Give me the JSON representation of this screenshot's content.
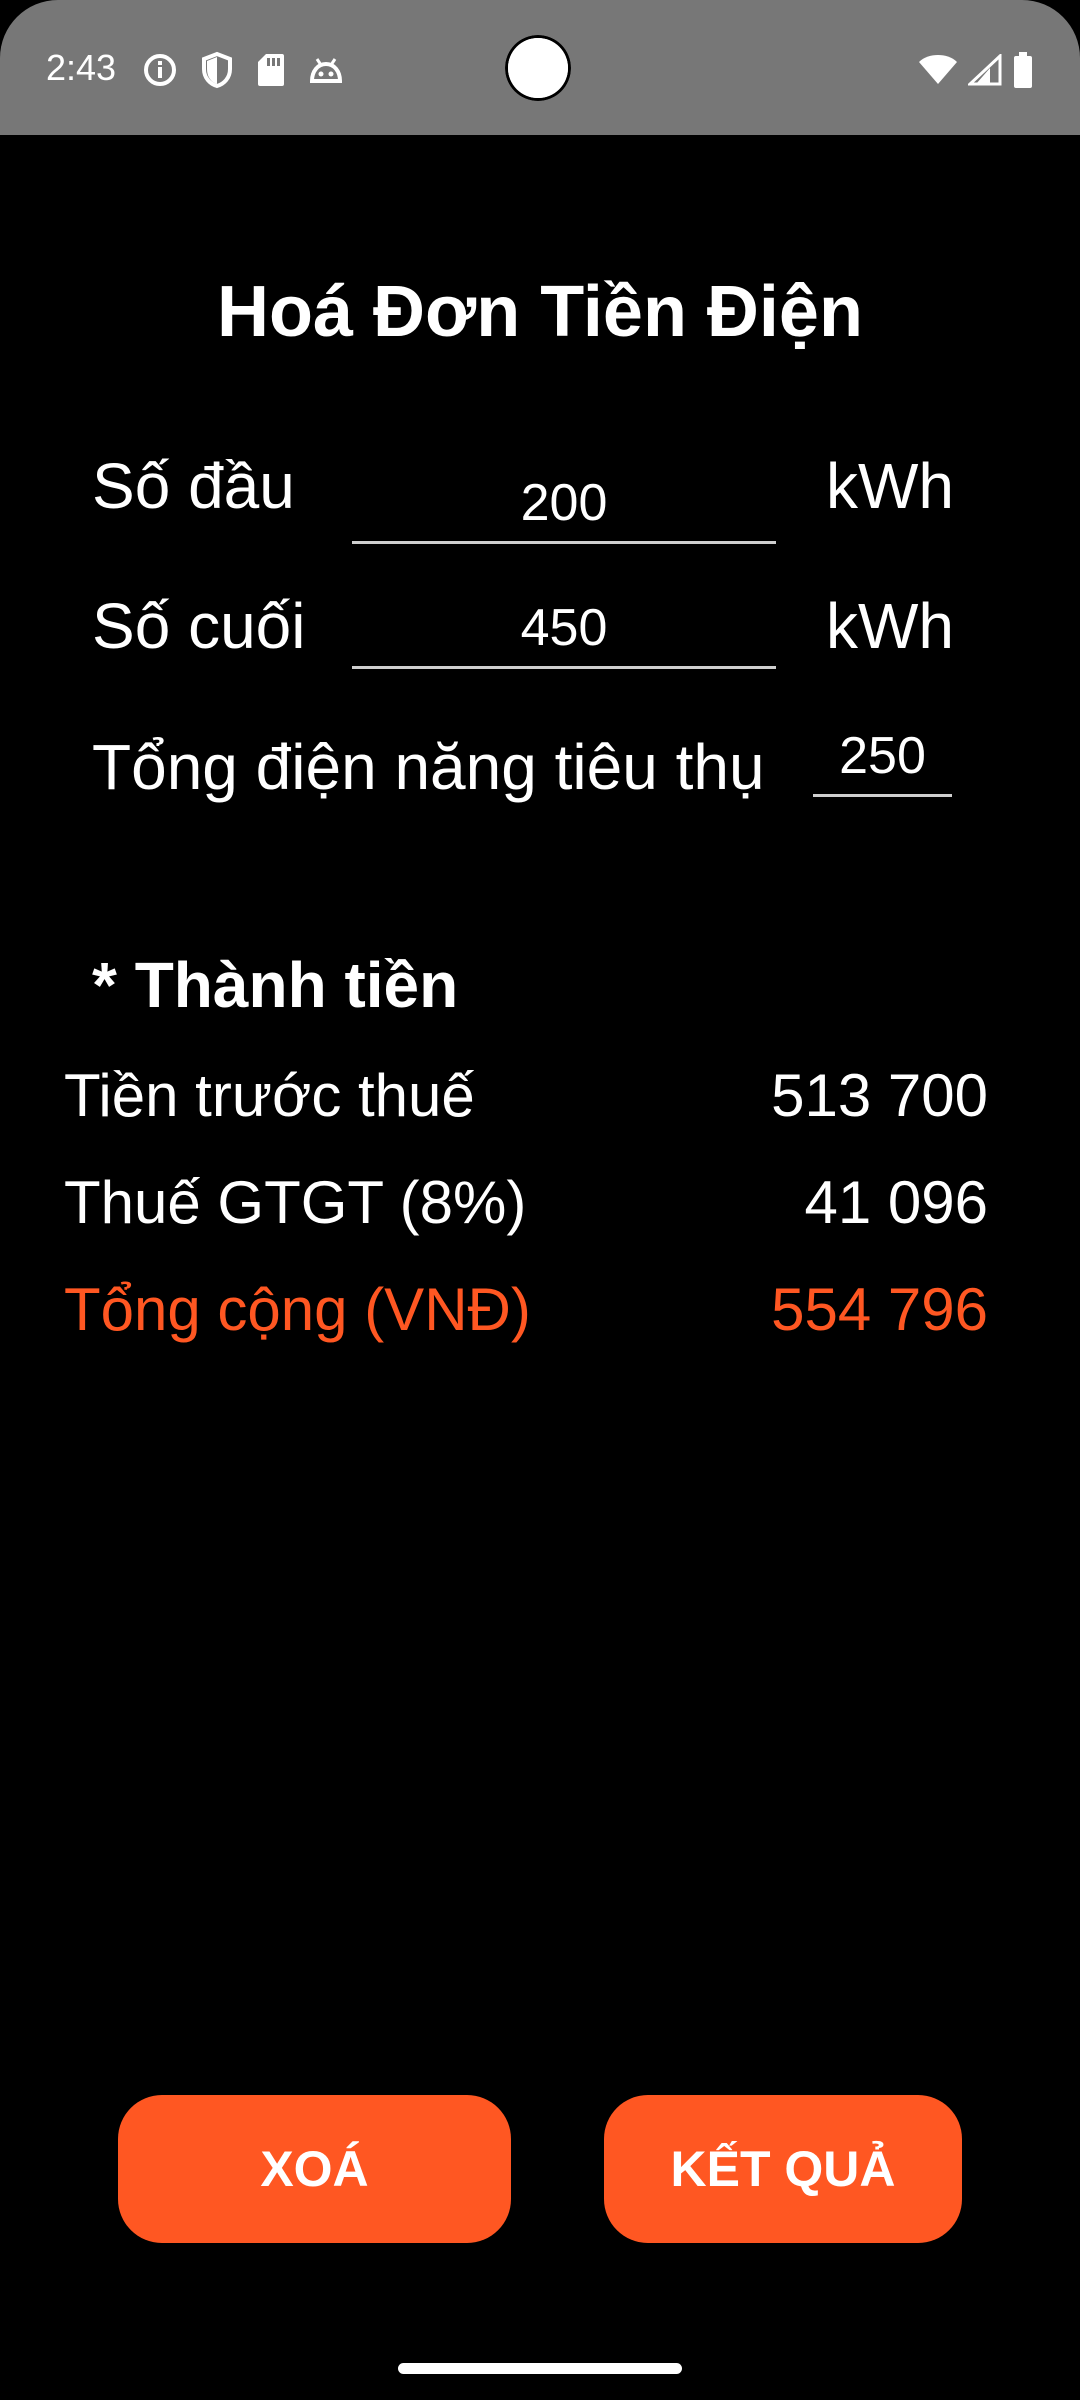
{
  "status_bar": {
    "time": "2:43",
    "left_icons": [
      "info-icon",
      "shield-icon",
      "sd-card-icon",
      "android-debug-icon"
    ],
    "right_icons": [
      "wifi-icon",
      "cell-signal-icon",
      "battery-icon"
    ],
    "background_color": "#777777"
  },
  "title": "Hoá Đơn Tiền Điện",
  "form": {
    "start_reading": {
      "label": "Số đầu",
      "value": "200",
      "unit": "kWh"
    },
    "end_reading": {
      "label": "Số cuối",
      "value": "450",
      "unit": "kWh"
    },
    "total_consumption": {
      "label": "Tổng điện năng tiêu thụ",
      "value": "250"
    }
  },
  "results": {
    "heading": "* Thành tiền",
    "pre_tax": {
      "label": "Tiền trước thuế",
      "value": "513 700"
    },
    "vat": {
      "label": "Thuế GTGT (8%)",
      "value": "41 096"
    },
    "total": {
      "label": "Tổng cộng (VNĐ)",
      "value": "554 796"
    }
  },
  "buttons": {
    "clear_label": "XOÁ",
    "result_label": "KẾT QUẢ"
  },
  "colors": {
    "accent": "#ff5722",
    "background": "#000000",
    "text": "#ffffff"
  }
}
